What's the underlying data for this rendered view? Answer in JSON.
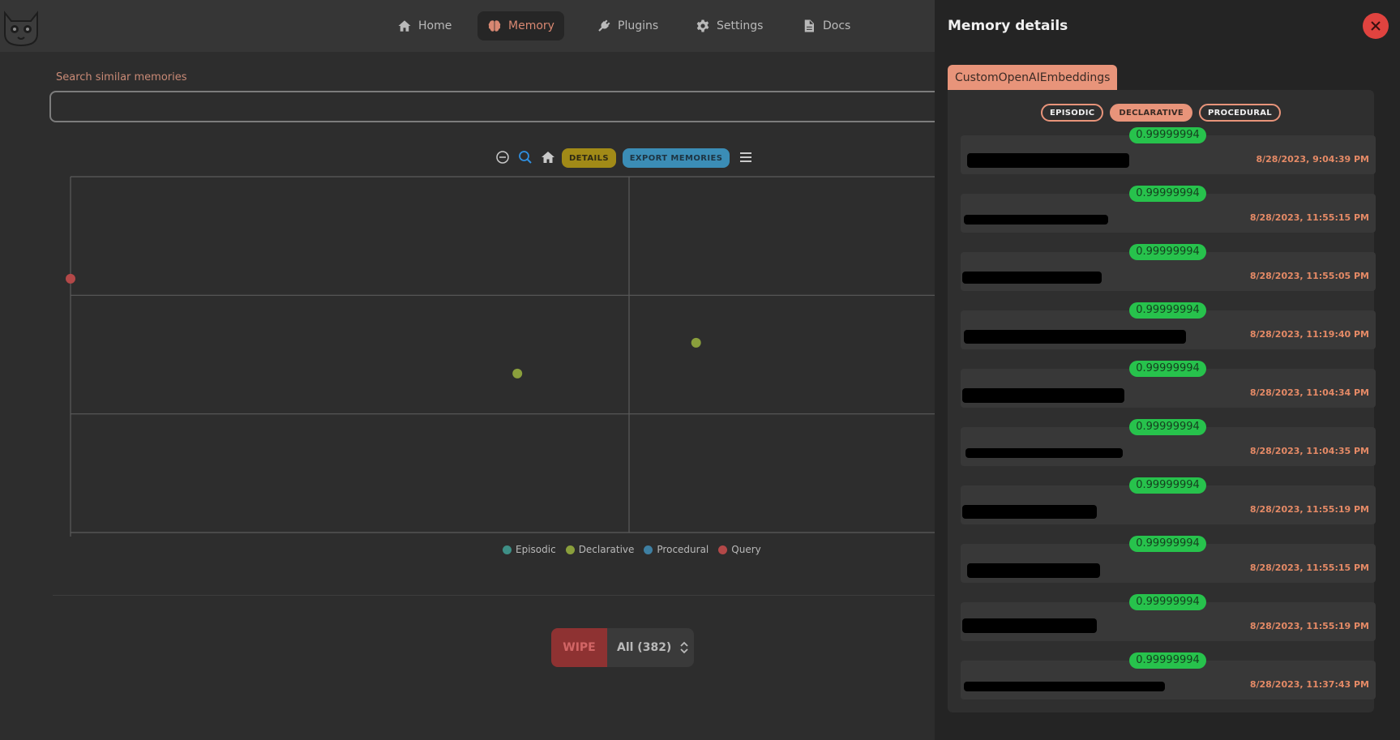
{
  "nav": {
    "items": [
      {
        "label": "Home",
        "icon": "home-icon"
      },
      {
        "label": "Memory",
        "icon": "brain-icon",
        "active": true
      },
      {
        "label": "Plugins",
        "icon": "plug-icon"
      },
      {
        "label": "Settings",
        "icon": "gear-icon"
      },
      {
        "label": "Docs",
        "icon": "document-icon"
      }
    ]
  },
  "search": {
    "label": "Search similar memories",
    "value": ""
  },
  "toolbar": {
    "details_label": "DETAILS",
    "export_label": "EXPORT MEMORIES"
  },
  "chart_data": {
    "type": "scatter",
    "series": [
      {
        "name": "Episodic",
        "color": "#3e8f86",
        "points": []
      },
      {
        "name": "Declarative",
        "color": "#8a9f3c",
        "points": [
          [
            -0.2,
            -0.33
          ],
          [
            0.12,
            -0.2
          ]
        ]
      },
      {
        "name": "Procedural",
        "color": "#3e7fa2",
        "points": []
      },
      {
        "name": "Query",
        "color": "#b34848",
        "points": [
          [
            -1,
            0.07
          ]
        ]
      }
    ],
    "xlim": [
      -1,
      1
    ],
    "ylim": [
      -1,
      0.5
    ],
    "grid": true,
    "legend": "bottom"
  },
  "wipe": {
    "button_label": "WIPE",
    "selected": "All (382)"
  },
  "panel": {
    "title": "Memory details",
    "embedder": "CustomOpenAIEmbeddings",
    "filters": [
      {
        "label": "EPISODIC",
        "active": false
      },
      {
        "label": "DECLARATIVE",
        "active": true
      },
      {
        "label": "PROCEDURAL",
        "active": false
      }
    ],
    "memories": [
      {
        "score": "0.99999994",
        "date": "8/28/2023, 9:04:39 PM"
      },
      {
        "score": "0.99999994",
        "date": "8/28/2023, 11:55:15 PM"
      },
      {
        "score": "0.99999994",
        "date": "8/28/2023, 11:55:05 PM"
      },
      {
        "score": "0.99999994",
        "date": "8/28/2023, 11:19:40 PM"
      },
      {
        "score": "0.99999994",
        "date": "8/28/2023, 11:04:34 PM"
      },
      {
        "score": "0.99999994",
        "date": "8/28/2023, 11:04:35 PM"
      },
      {
        "score": "0.99999994",
        "date": "8/28/2023, 11:55:19 PM"
      },
      {
        "score": "0.99999994",
        "date": "8/28/2023, 11:55:15 PM"
      },
      {
        "score": "0.99999994",
        "date": "8/28/2023, 11:55:19 PM"
      },
      {
        "score": "0.99999994",
        "date": "8/28/2023, 11:37:43 PM"
      }
    ]
  },
  "colors": {
    "accent": "#e8947a",
    "score_badge": "#27c24c",
    "close": "#e0433f",
    "wipe": "#8e3232"
  }
}
